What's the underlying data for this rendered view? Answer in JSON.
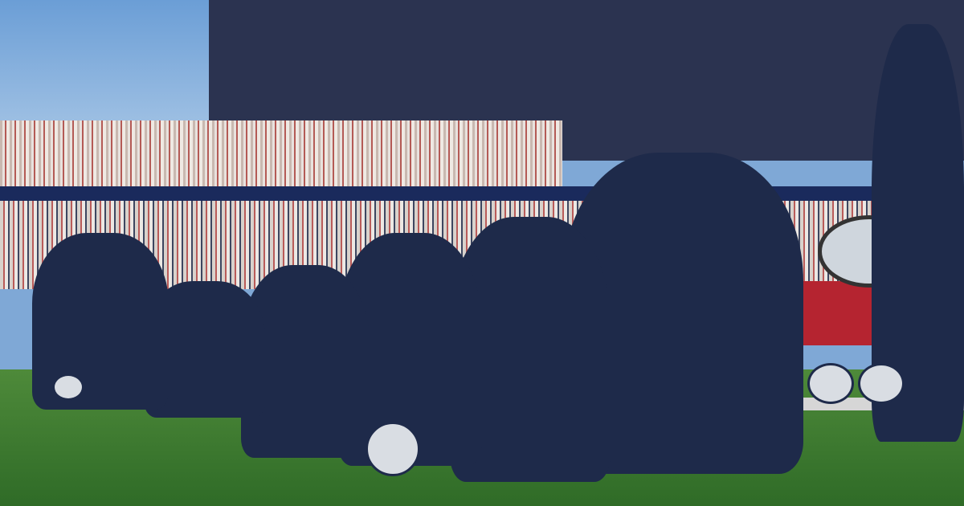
{
  "scene": {
    "description_tag": "photo",
    "colors": {
      "navy": "#1e2a4a",
      "red": "#b52430",
      "grass": "#3f7a31"
    }
  }
}
